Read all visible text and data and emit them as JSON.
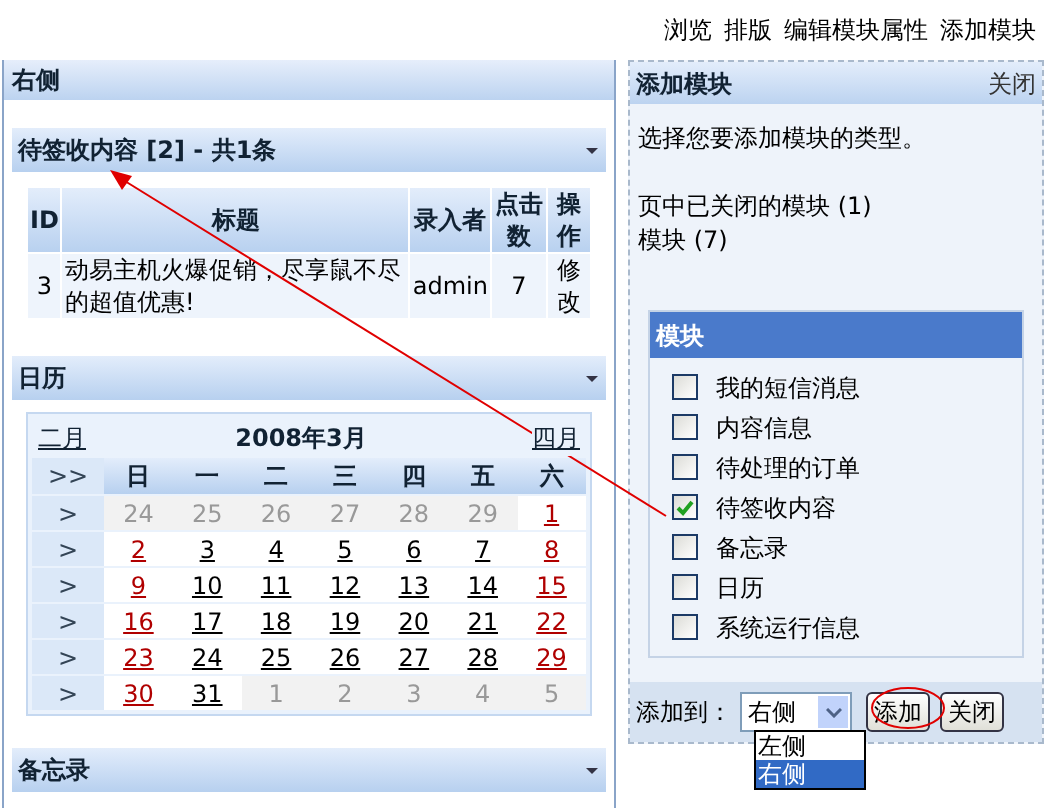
{
  "top_links": [
    "浏览",
    "排版",
    "编辑模块属性",
    "添加模块"
  ],
  "left_panel": {
    "title": "右侧",
    "modules": [
      {
        "kind": "table",
        "title": "待签收内容 [2] - 共1条",
        "columns": [
          "ID",
          "标题",
          "录入者",
          "点击数",
          "操作"
        ],
        "rows": [
          [
            "3",
            "动易主机火爆促销，尽享鼠不尽的超值优惠!",
            "admin",
            "7",
            "修改"
          ]
        ]
      },
      {
        "kind": "calendar",
        "title": "日历",
        "prev": "二月",
        "month": "2008年3月",
        "next": "四月",
        "all_weeks": ">>",
        "weekdays": [
          "日",
          "一",
          "二",
          "三",
          "四",
          "五",
          "六"
        ],
        "weeks": [
          {
            "nav": ">",
            "days": [
              {
                "text": "24",
                "kind": "other"
              },
              {
                "text": "25",
                "kind": "other"
              },
              {
                "text": "26",
                "kind": "other"
              },
              {
                "text": "27",
                "kind": "other"
              },
              {
                "text": "28",
                "kind": "other"
              },
              {
                "text": "29",
                "kind": "other"
              },
              {
                "text": "1",
                "kind": "weekend"
              }
            ]
          },
          {
            "nav": ">",
            "days": [
              {
                "text": "2",
                "kind": "weekend"
              },
              {
                "text": "3",
                "kind": "day"
              },
              {
                "text": "4",
                "kind": "day"
              },
              {
                "text": "5",
                "kind": "day"
              },
              {
                "text": "6",
                "kind": "day"
              },
              {
                "text": "7",
                "kind": "day"
              },
              {
                "text": "8",
                "kind": "weekend"
              }
            ]
          },
          {
            "nav": ">",
            "days": [
              {
                "text": "9",
                "kind": "weekend"
              },
              {
                "text": "10",
                "kind": "day"
              },
              {
                "text": "11",
                "kind": "day"
              },
              {
                "text": "12",
                "kind": "day"
              },
              {
                "text": "13",
                "kind": "day"
              },
              {
                "text": "14",
                "kind": "day"
              },
              {
                "text": "15",
                "kind": "weekend"
              }
            ]
          },
          {
            "nav": ">",
            "days": [
              {
                "text": "16",
                "kind": "weekend"
              },
              {
                "text": "17",
                "kind": "day"
              },
              {
                "text": "18",
                "kind": "day"
              },
              {
                "text": "19",
                "kind": "day"
              },
              {
                "text": "20",
                "kind": "day"
              },
              {
                "text": "21",
                "kind": "day"
              },
              {
                "text": "22",
                "kind": "weekend"
              }
            ]
          },
          {
            "nav": ">",
            "days": [
              {
                "text": "23",
                "kind": "weekend"
              },
              {
                "text": "24",
                "kind": "day"
              },
              {
                "text": "25",
                "kind": "day"
              },
              {
                "text": "26",
                "kind": "day"
              },
              {
                "text": "27",
                "kind": "day"
              },
              {
                "text": "28",
                "kind": "day"
              },
              {
                "text": "29",
                "kind": "weekend"
              }
            ]
          },
          {
            "nav": ">",
            "days": [
              {
                "text": "30",
                "kind": "weekend"
              },
              {
                "text": "31",
                "kind": "day"
              },
              {
                "text": "1",
                "kind": "other"
              },
              {
                "text": "2",
                "kind": "other"
              },
              {
                "text": "3",
                "kind": "other"
              },
              {
                "text": "4",
                "kind": "other"
              },
              {
                "text": "5",
                "kind": "other"
              }
            ]
          }
        ]
      },
      {
        "kind": "collapsed",
        "title": "备忘录"
      }
    ]
  },
  "add_panel": {
    "title": "添加模块",
    "close": "关闭",
    "intro": "选择您要添加模块的类型。",
    "lines": [
      "页中已关闭的模块 (1)",
      "模块 (7)"
    ],
    "list_title": "模块",
    "items": [
      {
        "label": "我的短信消息",
        "checked": false
      },
      {
        "label": "内容信息",
        "checked": false
      },
      {
        "label": "待处理的订单",
        "checked": false
      },
      {
        "label": "待签收内容",
        "checked": true
      },
      {
        "label": "备忘录",
        "checked": false
      },
      {
        "label": "日历",
        "checked": false
      },
      {
        "label": "系统运行信息",
        "checked": false
      }
    ],
    "target_label": "添加到：",
    "target": "右侧",
    "options": [
      {
        "label": "左侧",
        "selected": false
      },
      {
        "label": "右侧",
        "selected": true
      }
    ],
    "buttons": [
      "添加",
      "关闭"
    ]
  }
}
